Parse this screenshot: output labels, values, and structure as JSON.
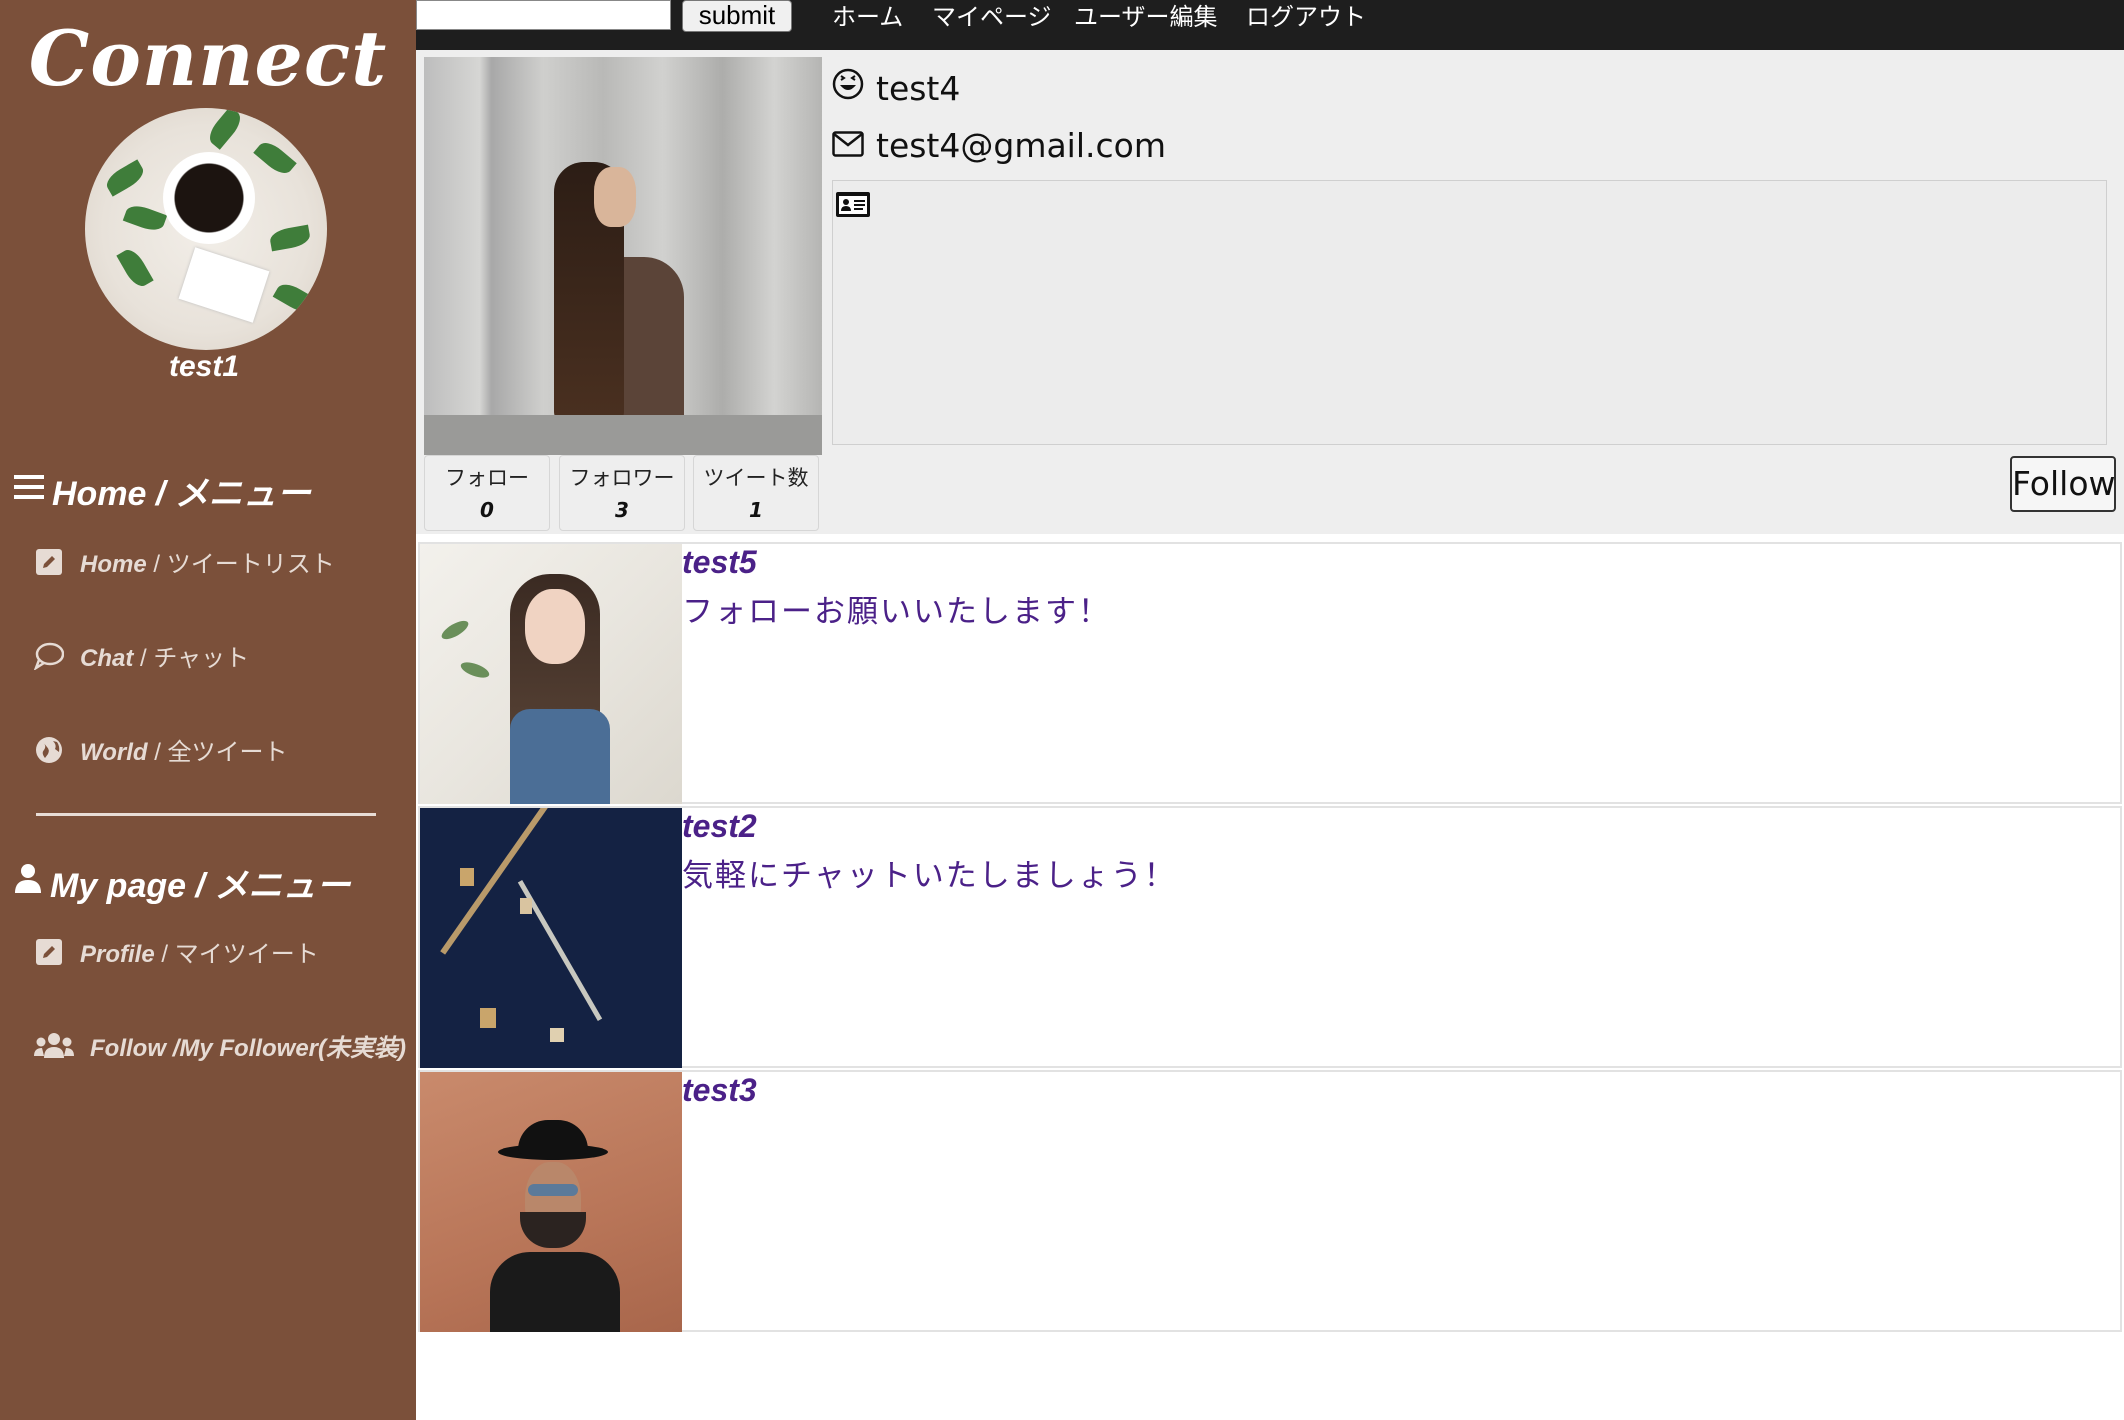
{
  "sidebar": {
    "logo": "Connect",
    "username": "test1",
    "home_section": {
      "title": "Home / メニュー",
      "items": [
        {
          "en": "Home",
          "ja": "/ ツイートリスト",
          "icon": "edit-icon"
        },
        {
          "en": "Chat",
          "ja": "/ チャット",
          "icon": "chat-bubble-icon"
        },
        {
          "en": "World",
          "ja": "/ 全ツイート",
          "icon": "globe-icon"
        }
      ]
    },
    "mypage_section": {
      "title": "My page / メニュー",
      "items": [
        {
          "en": "Profile",
          "ja": "/ マイツイート",
          "icon": "edit-icon"
        },
        {
          "en": "Follow /My Follower",
          "ja": "(未実装)",
          "icon": "users-icon"
        }
      ]
    }
  },
  "topbar": {
    "search_value": "",
    "submit_label": "submit",
    "nav": [
      "ホーム",
      "マイページ",
      "ユーザー編集",
      "ログアウト"
    ]
  },
  "profile": {
    "name": "test4",
    "email": "test4@gmail.com",
    "bio": "",
    "stats": [
      {
        "label": "フォロー",
        "value": "0"
      },
      {
        "label": "フォロワー",
        "value": "3"
      },
      {
        "label": "ツイート数",
        "value": "1"
      }
    ],
    "follow_label": "Follow"
  },
  "tweets": [
    {
      "author": "test5",
      "body": "フォローお願いいたします！"
    },
    {
      "author": "test2",
      "body": "気軽にチャットいたしましょう！"
    },
    {
      "author": "test3",
      "body": ""
    }
  ],
  "colors": {
    "sidebar_bg": "#7b503a",
    "topbar_bg": "#1e1e1e",
    "tweet_text": "#4b2188",
    "profile_bg": "#eeeeee"
  }
}
